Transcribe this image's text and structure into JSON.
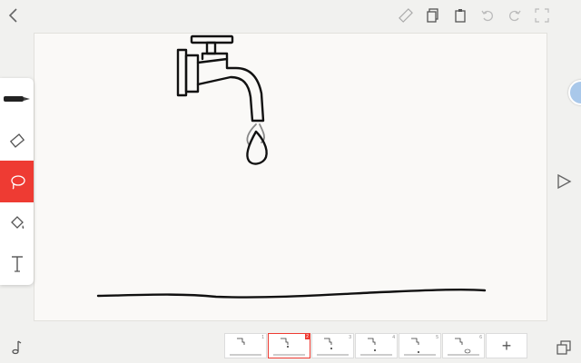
{
  "topbar": {
    "icons": [
      "back-icon",
      "ruler-icon",
      "copy-icon",
      "paste-icon",
      "undo-icon",
      "redo-icon",
      "fullscreen-icon"
    ]
  },
  "tools": [
    {
      "name": "pen",
      "icon": "pen-icon",
      "active": false
    },
    {
      "name": "eraser",
      "icon": "eraser-icon",
      "active": false
    },
    {
      "name": "lasso",
      "icon": "lasso-icon",
      "active": true
    },
    {
      "name": "fill",
      "icon": "paint-bucket-icon",
      "active": false
    },
    {
      "name": "text",
      "icon": "text-icon",
      "active": false
    }
  ],
  "colors": {
    "accent": "#ee3b33",
    "canvas": "#faf9f7",
    "stroke": "#111111"
  },
  "filmstrip": {
    "frames": [
      {
        "number": "1",
        "selected": false
      },
      {
        "number": "2",
        "selected": true
      },
      {
        "number": "3",
        "selected": false
      },
      {
        "number": "4",
        "selected": false
      },
      {
        "number": "5",
        "selected": false
      },
      {
        "number": "6",
        "selected": false
      }
    ],
    "add_label": "+"
  },
  "bottombar": {
    "left_icon": "music-note-icon",
    "right_icon": "layers-icon"
  }
}
